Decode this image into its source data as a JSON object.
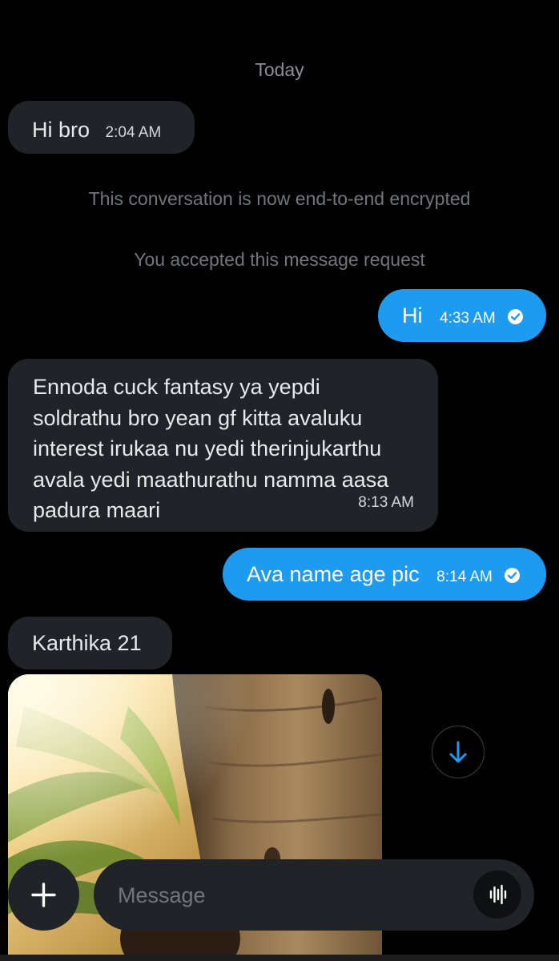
{
  "conversation": {
    "date_label": "Today",
    "system_notes": {
      "encrypted": "This conversation is now end-to-end encrypted",
      "accepted": "You accepted this message request"
    },
    "messages": [
      {
        "direction": "incoming",
        "text": "Hi bro",
        "time": "2:04 AM"
      },
      {
        "direction": "outgoing",
        "text": "Hi",
        "time": "4:33 AM",
        "status": "read"
      },
      {
        "direction": "incoming",
        "lines": [
          "Ennoda cuck fantasy ya yepdi",
          "soldrathu bro yean gf kitta avaluku",
          "interest irukaa nu yedi therinjukarthu",
          "avala yedi maathurathu namma aasa",
          "padura maari"
        ],
        "time": "8:13 AM"
      },
      {
        "direction": "outgoing",
        "text": "Ava name age pic",
        "time": "8:14 AM",
        "status": "read"
      },
      {
        "direction": "incoming",
        "text": "Karthika 21"
      },
      {
        "direction": "incoming",
        "media": "photo"
      }
    ]
  },
  "composer": {
    "placeholder": "Message",
    "add_icon": "plus-icon",
    "voice_icon": "waveform-icon"
  },
  "scroll_button_icon": "arrow-down-icon",
  "colors": {
    "background": "#000000",
    "incoming_bubble": "#202327",
    "outgoing_bubble": "#1d9bf0",
    "muted_text": "#71767b",
    "accent": "#1d9bf0"
  }
}
